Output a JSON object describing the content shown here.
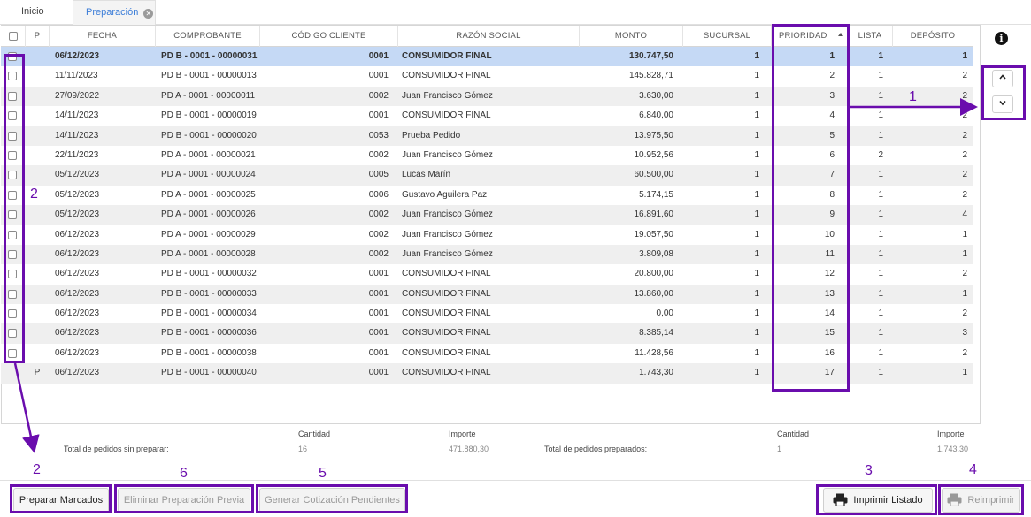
{
  "tabs": [
    {
      "label": "Inicio"
    },
    {
      "label": "Preparación"
    }
  ],
  "table": {
    "columns": [
      "P",
      "FECHA",
      "COMPROBANTE",
      "CÓDIGO CLIENTE",
      "RAZÓN SOCIAL",
      "MONTO",
      "SUCURSAL",
      "PRIORIDAD",
      "LISTA",
      "DEPÓSITO"
    ],
    "sorted_column": "PRIORIDAD",
    "rows": [
      {
        "p": "",
        "fecha": "06/12/2023",
        "comprobante": "PD B - 0001 - 00000031",
        "codigo": "0001",
        "razon": "CONSUMIDOR FINAL",
        "monto": "130.747,50",
        "sucursal": "1",
        "prioridad": "1",
        "lista": "1",
        "deposito": "1",
        "selected": true
      },
      {
        "p": "",
        "fecha": "11/11/2023",
        "comprobante": "PD B - 0001 - 00000013",
        "codigo": "0001",
        "razon": "CONSUMIDOR FINAL",
        "monto": "145.828,71",
        "sucursal": "1",
        "prioridad": "2",
        "lista": "1",
        "deposito": "2"
      },
      {
        "p": "",
        "fecha": "27/09/2022",
        "comprobante": "PD A - 0001 - 00000011",
        "codigo": "0002",
        "razon": "Juan Francisco Gómez",
        "monto": "3.630,00",
        "sucursal": "1",
        "prioridad": "3",
        "lista": "1",
        "deposito": "2"
      },
      {
        "p": "",
        "fecha": "14/11/2023",
        "comprobante": "PD B - 0001 - 00000019",
        "codigo": "0001",
        "razon": "CONSUMIDOR FINAL",
        "monto": "6.840,00",
        "sucursal": "1",
        "prioridad": "4",
        "lista": "1",
        "deposito": "2"
      },
      {
        "p": "",
        "fecha": "14/11/2023",
        "comprobante": "PD B - 0001 - 00000020",
        "codigo": "0053",
        "razon": "Prueba Pedido",
        "monto": "13.975,50",
        "sucursal": "1",
        "prioridad": "5",
        "lista": "1",
        "deposito": "2"
      },
      {
        "p": "",
        "fecha": "22/11/2023",
        "comprobante": "PD A - 0001 - 00000021",
        "codigo": "0002",
        "razon": "Juan Francisco Gómez",
        "monto": "10.952,56",
        "sucursal": "1",
        "prioridad": "6",
        "lista": "2",
        "deposito": "2"
      },
      {
        "p": "",
        "fecha": "05/12/2023",
        "comprobante": "PD A - 0001 - 00000024",
        "codigo": "0005",
        "razon": "Lucas Marín",
        "monto": "60.500,00",
        "sucursal": "1",
        "prioridad": "7",
        "lista": "1",
        "deposito": "2"
      },
      {
        "p": "",
        "fecha": "05/12/2023",
        "comprobante": "PD A - 0001 - 00000025",
        "codigo": "0006",
        "razon": "Gustavo Aguilera Paz",
        "monto": "5.174,15",
        "sucursal": "1",
        "prioridad": "8",
        "lista": "1",
        "deposito": "2"
      },
      {
        "p": "",
        "fecha": "05/12/2023",
        "comprobante": "PD A - 0001 - 00000026",
        "codigo": "0002",
        "razon": "Juan Francisco Gómez",
        "monto": "16.891,60",
        "sucursal": "1",
        "prioridad": "9",
        "lista": "1",
        "deposito": "4"
      },
      {
        "p": "",
        "fecha": "06/12/2023",
        "comprobante": "PD A - 0001 - 00000029",
        "codigo": "0002",
        "razon": "Juan Francisco Gómez",
        "monto": "19.057,50",
        "sucursal": "1",
        "prioridad": "10",
        "lista": "1",
        "deposito": "1"
      },
      {
        "p": "",
        "fecha": "06/12/2023",
        "comprobante": "PD A - 0001 - 00000028",
        "codigo": "0002",
        "razon": "Juan Francisco Gómez",
        "monto": "3.809,08",
        "sucursal": "1",
        "prioridad": "11",
        "lista": "1",
        "deposito": "1"
      },
      {
        "p": "",
        "fecha": "06/12/2023",
        "comprobante": "PD B - 0001 - 00000032",
        "codigo": "0001",
        "razon": "CONSUMIDOR FINAL",
        "monto": "20.800,00",
        "sucursal": "1",
        "prioridad": "12",
        "lista": "1",
        "deposito": "2"
      },
      {
        "p": "",
        "fecha": "06/12/2023",
        "comprobante": "PD B - 0001 - 00000033",
        "codigo": "0001",
        "razon": "CONSUMIDOR FINAL",
        "monto": "13.860,00",
        "sucursal": "1",
        "prioridad": "13",
        "lista": "1",
        "deposito": "1"
      },
      {
        "p": "",
        "fecha": "06/12/2023",
        "comprobante": "PD B - 0001 - 00000034",
        "codigo": "0001",
        "razon": "CONSUMIDOR FINAL",
        "monto": "0,00",
        "sucursal": "1",
        "prioridad": "14",
        "lista": "1",
        "deposito": "2"
      },
      {
        "p": "",
        "fecha": "06/12/2023",
        "comprobante": "PD B - 0001 - 00000036",
        "codigo": "0001",
        "razon": "CONSUMIDOR FINAL",
        "monto": "8.385,14",
        "sucursal": "1",
        "prioridad": "15",
        "lista": "1",
        "deposito": "3"
      },
      {
        "p": "",
        "fecha": "06/12/2023",
        "comprobante": "PD B - 0001 - 00000038",
        "codigo": "0001",
        "razon": "CONSUMIDOR FINAL",
        "monto": "11.428,56",
        "sucursal": "1",
        "prioridad": "16",
        "lista": "1",
        "deposito": "2"
      },
      {
        "p": "P",
        "fecha": "06/12/2023",
        "comprobante": "PD B - 0001 - 00000040",
        "codigo": "0001",
        "razon": "CONSUMIDOR FINAL",
        "monto": "1.743,30",
        "sucursal": "1",
        "prioridad": "17",
        "lista": "1",
        "deposito": "1",
        "no_checkbox": true
      }
    ]
  },
  "totals": {
    "cantidad_label": "Cantidad",
    "importe_label": "Importe",
    "sin_preparar_label": "Total de pedidos sin preparar:",
    "sin_preparar_cantidad": "16",
    "sin_preparar_importe": "471.880,30",
    "preparados_label": "Total de pedidos preparados:",
    "preparados_cantidad": "1",
    "preparados_importe": "1.743,30"
  },
  "buttons": {
    "preparar": "Preparar Marcados",
    "eliminar": "Eliminar Preparación Previa",
    "generar": "Generar Cotización Pendientes",
    "imprimir": "Imprimir Listado",
    "reimprimir": "Reimprimir"
  },
  "icons": {
    "info": "info-icon",
    "up": "chevron-up-icon",
    "down": "chevron-down-icon",
    "print": "printer-icon",
    "close": "close-icon"
  },
  "annotations": {
    "color": "#6a0dad",
    "labels": [
      "1",
      "2",
      "2",
      "6",
      "5",
      "3",
      "4"
    ]
  },
  "colors": {
    "selected_row": "#c5d9f5",
    "active_tab": "#3b7dd8",
    "stripe": "#efefef"
  }
}
